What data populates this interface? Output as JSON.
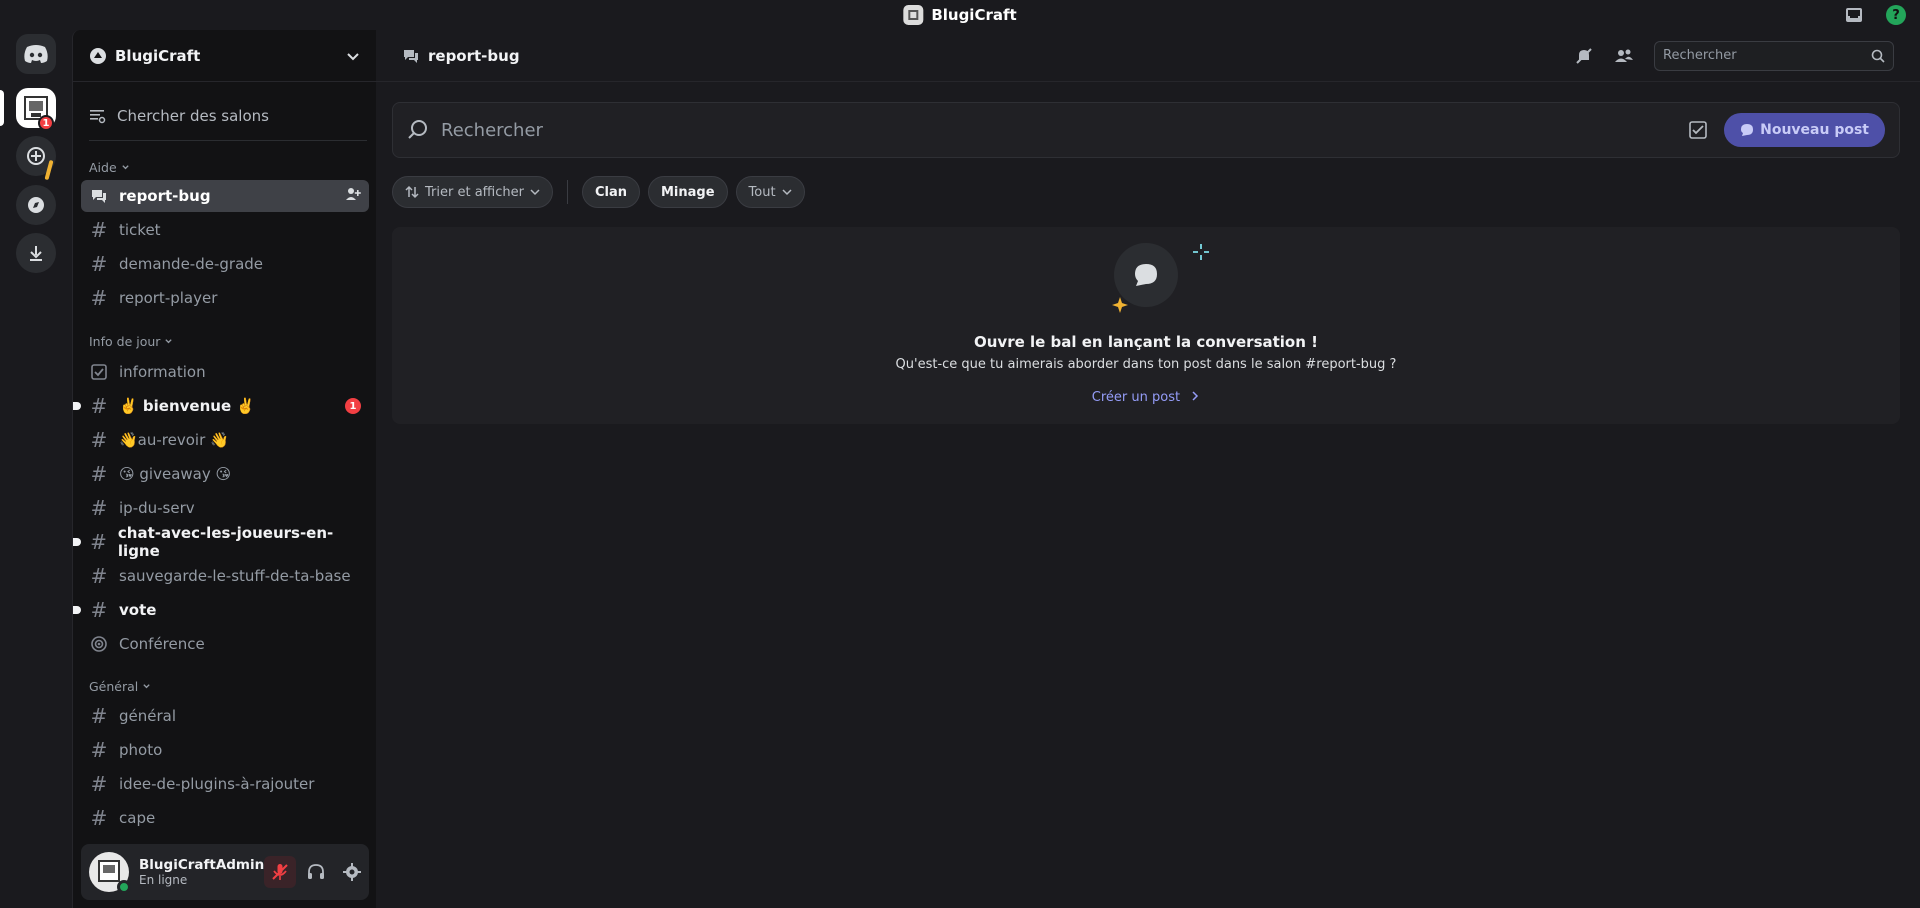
{
  "titlebar": {
    "app_name": "BlugiCraft",
    "help_glyph": "?"
  },
  "rail": {
    "server_badge": "1"
  },
  "sidebar": {
    "guild_name": "BlugiCraft",
    "browse_label": "Chercher des salons",
    "categories": [
      {
        "label": "Aide"
      },
      {
        "label": "Info de jour"
      },
      {
        "label": "Général"
      }
    ],
    "channels": [
      {
        "label": "report-bug",
        "icon": "forum-icon"
      },
      {
        "label": "ticket",
        "icon": "hash"
      },
      {
        "label": "demande-de-grade",
        "icon": "hash"
      },
      {
        "label": "report-player",
        "icon": "hash"
      },
      {
        "label": "information",
        "icon": "announcement-check-icon"
      },
      {
        "label": "✌️ bienvenue ✌️",
        "icon": "hash",
        "badge": "1"
      },
      {
        "label": "👋au-revoir 👋",
        "icon": "hash"
      },
      {
        "label": "😘 giveaway 😘",
        "icon": "hash"
      },
      {
        "label": "ip-du-serv",
        "icon": "hash"
      },
      {
        "label": "chat-avec-les-joueurs-en-ligne",
        "icon": "hash"
      },
      {
        "label": "sauvegarde-le-stuff-de-ta-base",
        "icon": "hash"
      },
      {
        "label": "vote",
        "icon": "hash"
      },
      {
        "label": "Conférence",
        "icon": "stage-icon"
      },
      {
        "label": "général",
        "icon": "hash"
      },
      {
        "label": "photo",
        "icon": "hash"
      },
      {
        "label": "idee-de-plugins-à-rajouter",
        "icon": "hash"
      },
      {
        "label": "cape",
        "icon": "hash"
      }
    ],
    "hash_glyph": "#"
  },
  "user": {
    "name": "BlugiCraftAdmin",
    "status": "En ligne"
  },
  "main": {
    "channel_title": "report-bug",
    "header_search_placeholder": "Rechercher",
    "forum_search_placeholder": "Rechercher",
    "new_post_label": "Nouveau post",
    "sort_label": "Trier et afficher",
    "tags": [
      "Clan",
      "Minage"
    ],
    "all_label": "Tout",
    "empty": {
      "title": "Ouvre le bal en lançant la conversation !",
      "subtitle": "Qu'est-ce que tu aimerais aborder dans ton post dans le salon #report-bug ?",
      "link": "Créer un post"
    }
  },
  "colors": {
    "accent": "#5865f2",
    "online": "#23a55a",
    "badge": "#f23f43",
    "link": "#949cf7"
  }
}
